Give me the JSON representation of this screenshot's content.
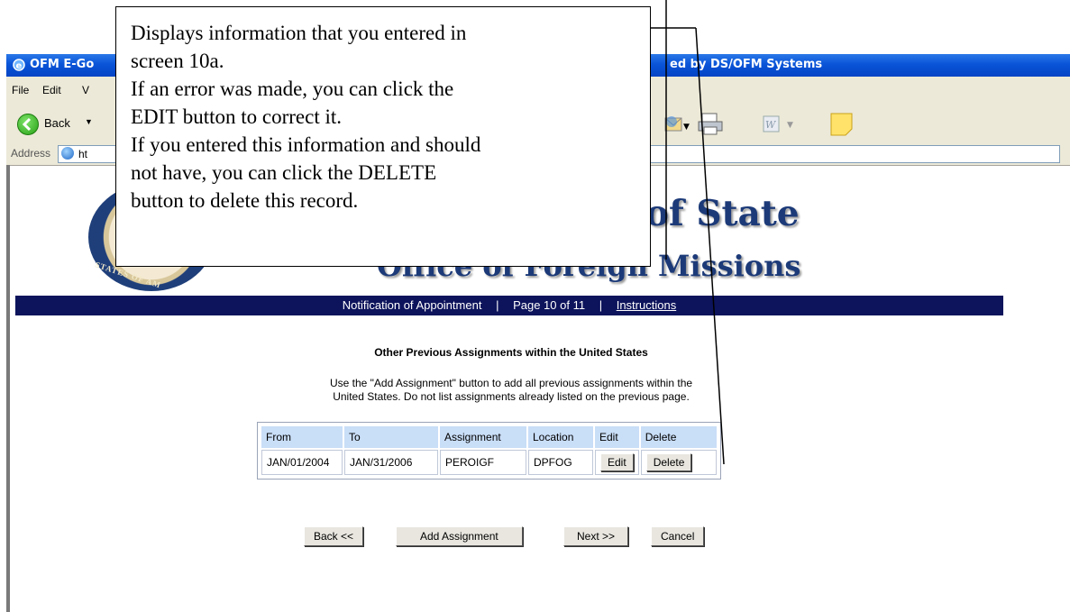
{
  "browser": {
    "title_left": "OFM E-Go",
    "title_right": "ed by DS/OFM Systems",
    "menu": [
      "File",
      "Edit",
      "V"
    ],
    "back_label": "Back",
    "address_label": "Address",
    "address_text": "ht"
  },
  "header": {
    "dept_title": "nt of State",
    "office_title": "Office of Foreign Missions",
    "seal_text": "STATES OF AM"
  },
  "nav": {
    "form_name": "Notification of Appointment",
    "page": "Page 10 of 11",
    "instructions_link": "Instructions",
    "separator": "|"
  },
  "section": {
    "heading": "Other Previous Assignments within the United States",
    "instructions_line1": "Use the \"Add Assignment\" button to add all previous assignments within the",
    "instructions_line2": "United States. Do not list assignments already listed on the previous page."
  },
  "table": {
    "headers": [
      "From",
      "To",
      "Assignment",
      "Location",
      "Edit",
      "Delete"
    ],
    "row": {
      "from": "JAN/01/2004",
      "to": "JAN/31/2006",
      "assignment": "PEROIGF",
      "location": "DPFOG",
      "edit_label": "Edit",
      "delete_label": "Delete"
    }
  },
  "buttons": {
    "back": "Back <<",
    "add": "Add Assignment",
    "next": "Next >>",
    "cancel": "Cancel"
  },
  "callout": {
    "lines": [
      "Displays information that you entered in",
      "screen 10a.",
      "If an error was made, you can click the",
      "EDIT button to correct it.",
      "If you entered this information and should",
      "not have, you can click the DELETE",
      "button to delete this record."
    ]
  }
}
